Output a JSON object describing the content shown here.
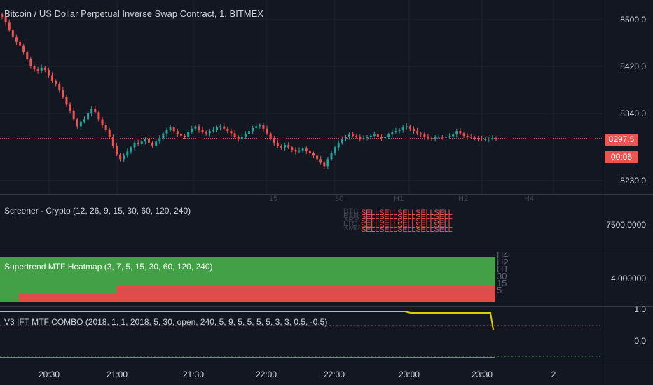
{
  "chart_data": {
    "type": "candlestick",
    "title": "Bitcoin / US Dollar Perpetual Inverse Swap Contract, 1, BITMEX",
    "price_axis_ticks": [
      "8500.0",
      "8420.0",
      "8340.0",
      "8230.0"
    ],
    "last_price": "8297.5",
    "countdown": "00:06",
    "time_axis_ticks": [
      "20:30",
      "21:00",
      "21:30",
      "22:00",
      "22:30",
      "23:00",
      "23:30",
      "2"
    ],
    "faint_date_ticks": [
      "15",
      "30",
      "H1",
      "H2",
      "H4"
    ],
    "close_series": [
      8505,
      8495,
      8482,
      8470,
      8462,
      8455,
      8445,
      8432,
      8420,
      8415,
      8412,
      8418,
      8414,
      8405,
      8395,
      8390,
      8380,
      8368,
      8355,
      8345,
      8330,
      8318,
      8326,
      8330,
      8340,
      8348,
      8342,
      8330,
      8320,
      8312,
      8300,
      8285,
      8270,
      8262,
      8268,
      8275,
      8282,
      8290,
      8288,
      8292,
      8296,
      8290,
      8285,
      8292,
      8298,
      8306,
      8312,
      8316,
      8310,
      8305,
      8302,
      8300,
      8308,
      8314,
      8318,
      8312,
      8308,
      8306,
      8310,
      8312,
      8316,
      8318,
      8314,
      8310,
      8306,
      8300,
      8296,
      8300,
      8305,
      8310,
      8315,
      8318,
      8320,
      8314,
      8306,
      8298,
      8290,
      8284,
      8282,
      8286,
      8282,
      8278,
      8275,
      8277,
      8280,
      8276,
      8272,
      8268,
      8262,
      8256,
      8250,
      8262,
      8272,
      8282,
      8290,
      8296,
      8300,
      8304,
      8302,
      8300,
      8297,
      8298,
      8300,
      8302,
      8304,
      8300,
      8298,
      8300,
      8304,
      8308,
      8310,
      8312,
      8316,
      8318,
      8314,
      8310,
      8306,
      8304,
      8300,
      8298,
      8297,
      8299,
      8300,
      8299,
      8300,
      8301,
      8304,
      8310,
      8306,
      8302,
      8300,
      8299,
      8298,
      8297,
      8296,
      8296,
      8297,
      8298,
      8297
    ]
  },
  "screener": {
    "title": "Screener - Crypto (12, 26, 9, 15, 30, 60, 120, 240)",
    "axis_tick": "7500.0000",
    "ghost_labels": [
      "BTC",
      "ETH",
      "XRP",
      "LTC",
      "XMR"
    ],
    "signal_text": "SELLSELLSELLSELLSELL"
  },
  "heatmap": {
    "title": "Supertrend MTF Heatmap (3, 7, 5, 15, 30, 60, 120, 240)",
    "axis_tick": "4.000000",
    "row_labels": [
      "H4",
      "H2",
      "H1",
      "30",
      "15",
      "5"
    ],
    "colors": {
      "bull": "#43a047",
      "bear": "#e04b4b"
    }
  },
  "ift": {
    "title": "V3 IFT MTF COMBO (2018, 1, 1, 2018, 5, 30, open, 240, 5, 9, 5, 5, 5, 5, 3, 3, 0.5, -0.5)",
    "axis_ticks": [
      "1.0",
      "0.0"
    ]
  },
  "colors": {
    "up": "#26a69a",
    "down": "#ef5350",
    "background": "#131722",
    "grid": "#1f2330"
  }
}
